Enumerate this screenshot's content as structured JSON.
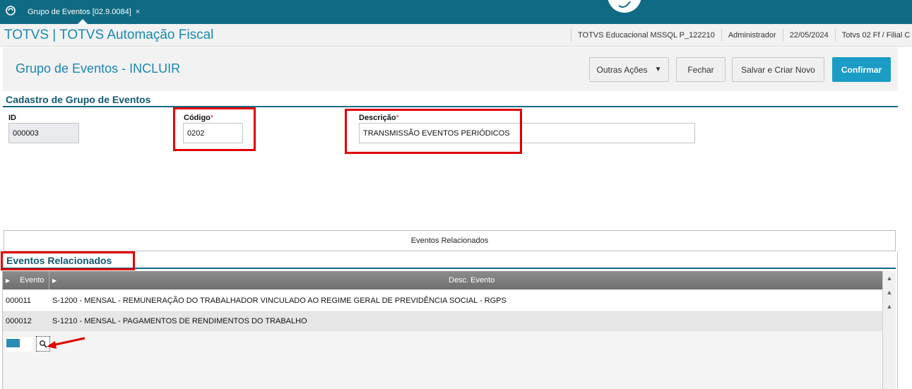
{
  "tabbar": {
    "tab_label": "Grupo de Eventos [02.9.0084]",
    "tab_close": "×"
  },
  "appbar": {
    "title": "TOTVS | TOTVS Automação Fiscal",
    "environment": "TOTVS Educacional MSSQL P_122210",
    "user": "Administrador",
    "date": "22/05/2024",
    "branch": "Totvs 02 Ff / Filial C"
  },
  "page": {
    "title": "Grupo de Eventos - INCLUIR",
    "buttons": {
      "more_actions": "Outras Ações",
      "close": "Fechar",
      "save_new": "Salvar e Criar Novo",
      "confirm": "Confirmar"
    }
  },
  "form": {
    "section_title": "Cadastro de Grupo de Eventos",
    "id_label": "ID",
    "id_value": "000003",
    "code_label": "Código",
    "code_value": "0202",
    "desc_label": "Descrição",
    "desc_value": "TRANSMISSÃO EVENTOS PERIÓDICOS",
    "required_mark": "*"
  },
  "related": {
    "folder_label": "Eventos Relacionados",
    "section_title": "Eventos Relacionados",
    "columns": [
      "Evento",
      "Desc. Evento"
    ],
    "rows": [
      {
        "code": "000011",
        "desc": "S-1200 - MENSAL - REMUNERAÇÃO DO TRABALHADOR VINCULADO AO REGIME GERAL DE PREVIDÊNCIA SOCIAL - RGPS"
      },
      {
        "code": "000012",
        "desc": "S-1210 - MENSAL - PAGAMENTOS DE RENDIMENTOS DO TRABALHO"
      }
    ]
  },
  "colors": {
    "topbar": "#0f6b83",
    "accent": "#1a88b0",
    "confirm": "#1a9cc5",
    "highlight": "#e00000"
  },
  "icons": {
    "home": "home-circle-icon",
    "chat": "chat-bubble-icon",
    "lookup": "magnifier-icon",
    "dropdown": "caret-down-icon",
    "arrow": "red-arrow-icon"
  }
}
